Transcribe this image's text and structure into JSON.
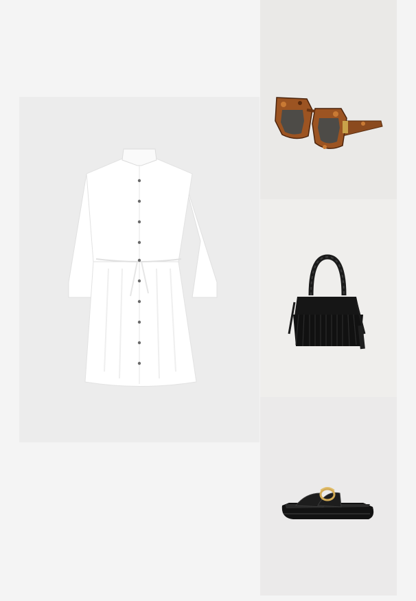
{
  "page": {
    "background_color": "#f4f4f4"
  },
  "outfit": {
    "items": [
      {
        "id": "dress",
        "icon": "white-shirt-dress",
        "background_color": "#ececec"
      },
      {
        "id": "sunglasses",
        "icon": "tortoiseshell-sunglasses",
        "background_color": "#eae9e7"
      },
      {
        "id": "bag",
        "icon": "black-fringe-bag",
        "background_color": "#efeeec"
      },
      {
        "id": "sandal",
        "icon": "black-slide-sandal",
        "background_color": "#ebeaea"
      }
    ]
  }
}
